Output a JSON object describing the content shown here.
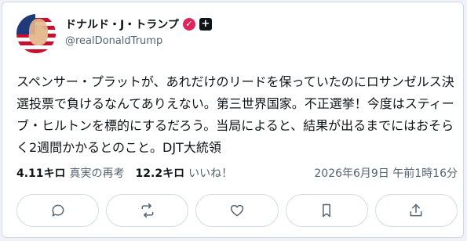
{
  "post": {
    "display_name": "ドナルド・J・トランプ",
    "handle": "@realDonaldTrump",
    "text": "スペンサー・プラットが、あれだけのリードを保っていたのにロサンゼルス決選投票で負けるなんてありえない。第三世界国家。不正選挙！今度はスティーブ・ヒルトンを標的にするだろう。当局によると、結果が出るまでにはおそらく2週間かかるとのこと。DJT大統領",
    "reposts_count": "4.11キロ",
    "reposts_label": "真実の再考",
    "likes_count": "12.2キロ",
    "likes_label": "いいね！",
    "timestamp": "2026年6月9日 午前1時16分"
  },
  "badges": {
    "verified_icon": "✓",
    "affiliate_icon": "+"
  },
  "icons": [
    "reply-icon",
    "repost-icon",
    "like-icon",
    "bookmark-icon",
    "share-icon"
  ],
  "colors": {
    "verified": "#e0245e",
    "text": "#0f1419",
    "muted": "#536471",
    "border": "#cfd9e6"
  }
}
